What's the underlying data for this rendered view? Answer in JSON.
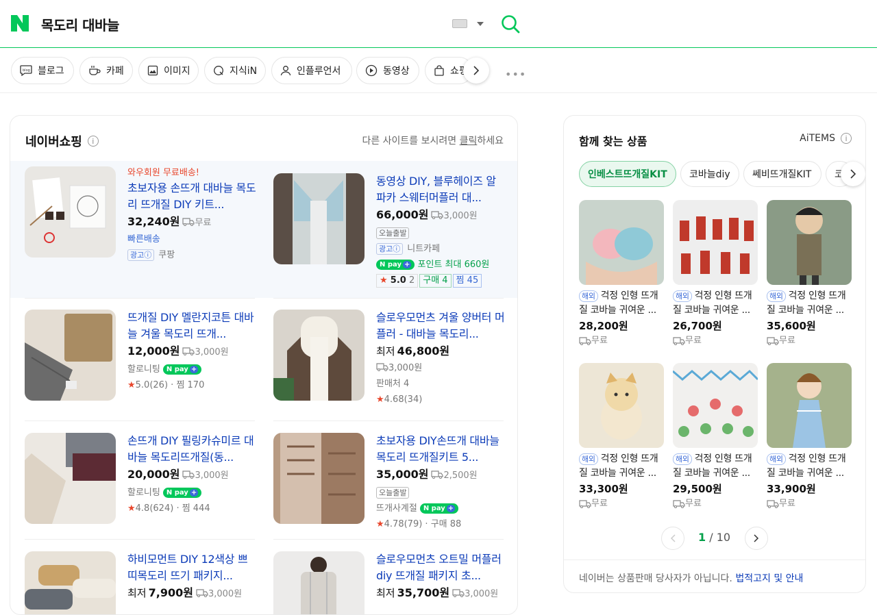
{
  "search": {
    "query": "목도리 대바늘"
  },
  "colors": {
    "accent": "#03c75a",
    "link": "#0d3cb8",
    "promo": "#e8472d"
  },
  "tabs": [
    {
      "label": "블로그",
      "icon": "blog-icon"
    },
    {
      "label": "카페",
      "icon": "cafe-cup-icon"
    },
    {
      "label": "이미지",
      "icon": "image-icon"
    },
    {
      "label": "지식iN",
      "icon": "kin-icon"
    },
    {
      "label": "인플루언서",
      "icon": "person-icon"
    },
    {
      "label": "동영상",
      "icon": "play-icon"
    },
    {
      "label": "쇼핑",
      "icon": "shopping-bag-icon"
    }
  ],
  "shopping": {
    "title": "네이버쇼핑",
    "note_prefix": "다른 사이트를 보시려면 ",
    "note_link": "클릭",
    "note_suffix": "하세요",
    "products": [
      {
        "promo": "와우회원 무료배송!",
        "title": "초보자용 손뜨개 대바늘 목도리 뜨개질 DIY 키트...",
        "price": "32,240원",
        "ship": "무료",
        "fast": "빠른배송",
        "ad": "광고",
        "seller": "쿠팡"
      },
      {
        "title": "동영상 DIY, 블루헤이즈 알파카 스웨터머플러 대...",
        "price": "66,000원",
        "ship": "3,000원",
        "badge": "오늘출발",
        "ad": "광고",
        "seller": "니트카페",
        "npay": "pay",
        "point": "포인트 최대 660원",
        "rating": "5.0",
        "rating_count": "2",
        "buy": "구매 4",
        "zzim": "찜 45"
      },
      {
        "title": "뜨개질 DIY 멜란지코튼 대바늘 겨울 목도리 뜨개...",
        "price": "12,000원",
        "ship": "3,000원",
        "seller": "할로니팅",
        "npay": "pay",
        "rating": "5.0",
        "rating_count": "(26)",
        "zzim": "찜 170"
      },
      {
        "title": "슬로우모먼츠 겨울 양버터 머플러 - 대바늘 목도리...",
        "price_label": "최저",
        "price": "46,800원",
        "ship": "3,000원",
        "sellers": "판매처 4",
        "rating": "4.68",
        "rating_count": "(34)"
      },
      {
        "title": "손뜨개 DIY 필링카슈미르 대바늘 목도리뜨개질(동...",
        "price": "20,000원",
        "ship": "3,000원",
        "seller": "할로니팅",
        "npay": "pay",
        "rating": "4.8",
        "rating_count": "(624)",
        "zzim": "찜 444"
      },
      {
        "title": "초보자용 DIY손뜨개 대바늘목도리 뜨개질키트 5...",
        "price": "35,000원",
        "ship": "2,500원",
        "badge": "오늘출발",
        "seller": "뜨개사계절",
        "npay": "pay",
        "rating": "4.78",
        "rating_count": "(79)",
        "buy": "구매 88"
      },
      {
        "title": "하비모먼트 DIY 12색상 쁘띠목도리 뜨기 패키지...",
        "price_label": "최저",
        "price": "7,900원",
        "ship": "3,000원"
      },
      {
        "title": "슬로우모먼츠 오트밀 머플러 diy 뜨개질 패키지 초...",
        "price_label": "최저",
        "price": "35,700원",
        "ship": "3,000원"
      }
    ]
  },
  "related": {
    "title": "함께 찾는 상품",
    "brand": "AiTEMS",
    "categories": [
      "인베스트뜨개질KIT",
      "코바늘diy",
      "쎄비뜨개질KIT",
      "코바"
    ],
    "items": [
      {
        "tag": "해외",
        "name": "걱정 인형 뜨개질 코바늘 귀여운 ...",
        "price": "28,200원",
        "ship": "무료"
      },
      {
        "tag": "해외",
        "name": "걱정 인형 뜨개질 코바늘 귀여운 ...",
        "price": "26,700원",
        "ship": "무료"
      },
      {
        "tag": "해외",
        "name": "걱정 인형 뜨개질 코바늘 귀여운 ...",
        "price": "35,600원",
        "ship": "무료"
      },
      {
        "tag": "해외",
        "name": "걱정 인형 뜨개질 코바늘 귀여운 ...",
        "price": "33,300원",
        "ship": "무료"
      },
      {
        "tag": "해외",
        "name": "걱정 인형 뜨개질 코바늘 귀여운 ...",
        "price": "29,500원",
        "ship": "무료"
      },
      {
        "tag": "해외",
        "name": "걱정 인형 뜨개질 코바늘 귀여운 ...",
        "price": "33,900원",
        "ship": "무료"
      }
    ],
    "page_current": "1",
    "page_sep": "/",
    "page_total": "10",
    "footnote": "네이버는 상품판매 당사자가 아닙니다.",
    "footnote_link": "법적고지 및 안내"
  }
}
